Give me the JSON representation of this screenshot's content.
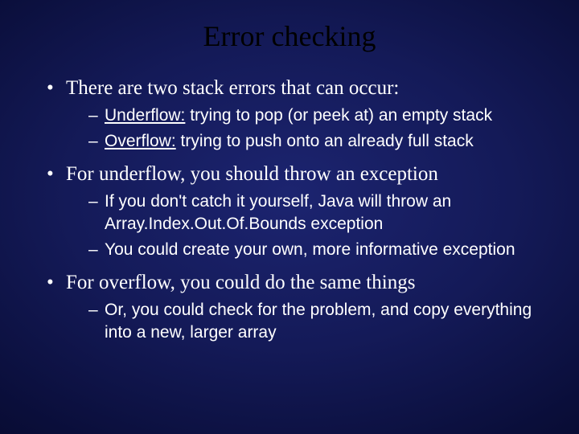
{
  "title": "Error checking",
  "b1": {
    "text": "There are two stack errors that can occur:",
    "s1": {
      "term": "Underflow:",
      "rest": " trying to pop (or peek at) an empty stack"
    },
    "s2": {
      "term": "Overflow:",
      "rest": " trying to push onto an already full stack"
    }
  },
  "b2": {
    "text": "For underflow, you should throw an exception",
    "s1": {
      "pre": "If you don't catch it yourself, Java will throw an ",
      "code": "Array.Index.Out.Of.Bounds",
      "post": " exception"
    },
    "s2": "You could create your own, more informative exception"
  },
  "b3": {
    "text": "For overflow, you could do the same things",
    "s1": "Or, you could check for the problem, and copy everything into a new, larger array"
  }
}
